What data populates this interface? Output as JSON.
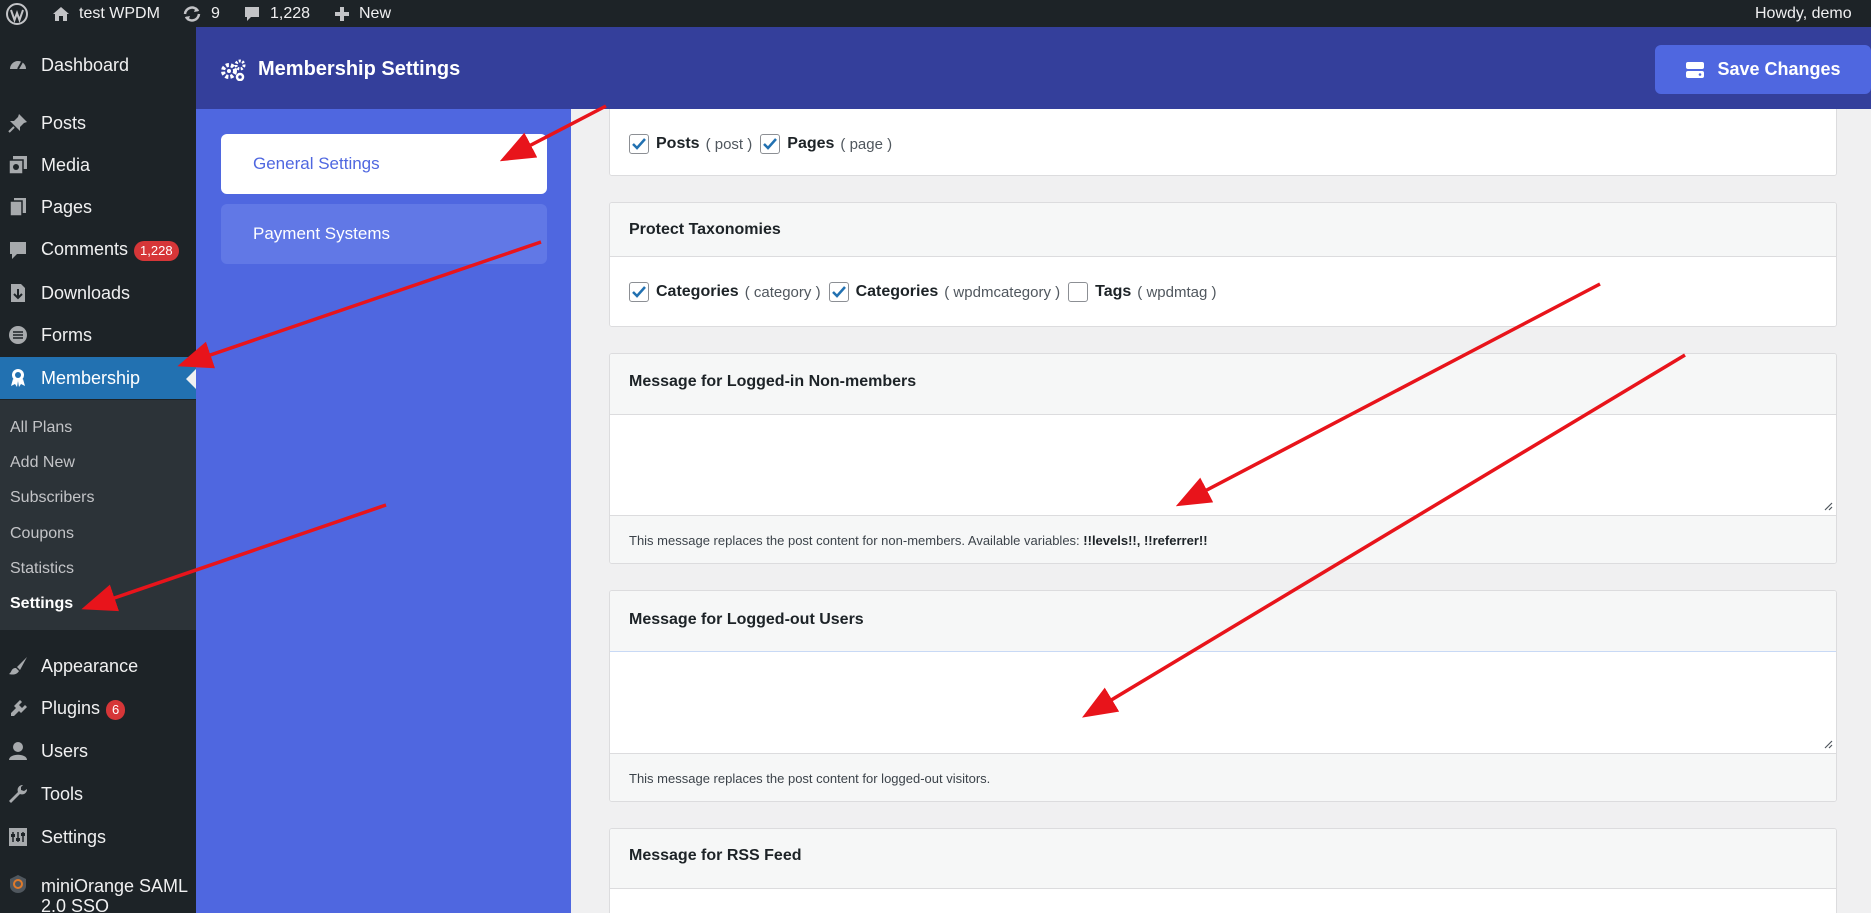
{
  "adminbar": {
    "site_name": "test WPDM",
    "updates_count": "9",
    "comments_count": "1,228",
    "new_label": "New",
    "howdy": "Howdy, demo"
  },
  "sidebar": {
    "items": [
      {
        "label": "Dashboard",
        "icon": "dashboard-icon"
      },
      {
        "label": "Posts",
        "icon": "pin-icon"
      },
      {
        "label": "Media",
        "icon": "media-icon"
      },
      {
        "label": "Pages",
        "icon": "pages-icon"
      },
      {
        "label": "Comments",
        "icon": "comment-icon",
        "badge": "1,228"
      },
      {
        "label": "Downloads",
        "icon": "download-icon"
      },
      {
        "label": "Forms",
        "icon": "forms-icon"
      },
      {
        "label": "Membership",
        "icon": "award-icon",
        "active": true
      },
      {
        "label": "Appearance",
        "icon": "brush-icon"
      },
      {
        "label": "Plugins",
        "icon": "plugin-icon",
        "badge": "6"
      },
      {
        "label": "Users",
        "icon": "user-icon"
      },
      {
        "label": "Tools",
        "icon": "wrench-icon"
      },
      {
        "label": "Settings",
        "icon": "settings-icon"
      },
      {
        "label": "miniOrange SAML 2.0 SSO",
        "icon": "miniorange-icon"
      }
    ],
    "submenu": [
      "All Plans",
      "Add New",
      "Subscribers",
      "Coupons",
      "Statistics",
      "Settings"
    ]
  },
  "header": {
    "title": "Membership Settings",
    "save_label": "Save Changes"
  },
  "nav": {
    "tabs": [
      "General Settings",
      "Payment Systems"
    ]
  },
  "content": {
    "post_types": [
      {
        "label": "Posts",
        "slug": "( post )",
        "checked": true
      },
      {
        "label": "Pages",
        "slug": "( page )",
        "checked": true
      }
    ],
    "taxonomies": {
      "title": "Protect Taxonomies",
      "items": [
        {
          "label": "Categories",
          "slug": "( category )",
          "checked": true
        },
        {
          "label": "Categories",
          "slug": "( wpdmcategory )",
          "checked": true
        },
        {
          "label": "Tags",
          "slug": "( wpdmtag )",
          "checked": false
        }
      ]
    },
    "msg_nonmembers": {
      "title": "Message for Logged-in Non-members",
      "value": "",
      "help": "This message replaces the post content for non-members. Available variables: ",
      "vars": "!!levels!!, !!referrer!!"
    },
    "msg_loggedout": {
      "title": "Message for Logged-out Users",
      "value": "",
      "help": "This message replaces the post content for logged-out visitors."
    },
    "msg_rss": {
      "title": "Message for RSS Feed"
    }
  },
  "colors": {
    "admin_dark": "#1d2327",
    "wp_blue": "#2271b1",
    "header_blue": "#343f9b",
    "nav_blue": "#4f67e0",
    "arrow_red": "#e8141b"
  }
}
